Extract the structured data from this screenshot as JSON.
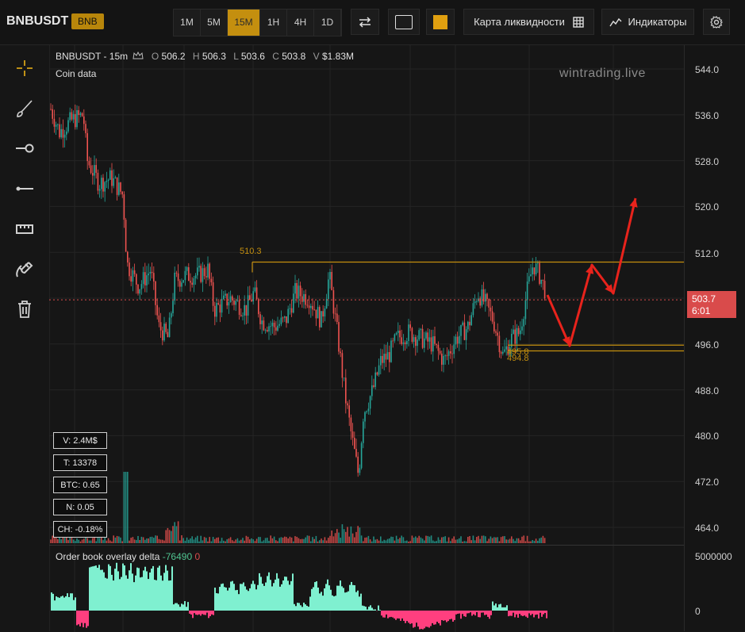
{
  "header": {
    "symbol": "BNBUSDT",
    "asset": "BNB",
    "timeframes": [
      "1M",
      "5M",
      "15M",
      "1H",
      "4H",
      "1D"
    ],
    "active_timeframe": "15M",
    "liquidity_map_label": "Карта ликвидности",
    "indicators_label": "Индикаторы"
  },
  "legend": {
    "title": "BNBUSDT - 15m",
    "o_label": "O",
    "o_value": "506.2",
    "h_label": "H",
    "h_value": "506.3",
    "l_label": "L",
    "l_value": "503.6",
    "c_label": "C",
    "c_value": "503.8",
    "v_label": "V",
    "v_value": "$1.83M",
    "coin_data": "Coin data"
  },
  "watermark": "wintrading.live",
  "stats": {
    "volume": "V: 2.4M$",
    "trades": "T: 13378",
    "btc": "BTC: 0.65",
    "n": "N: 0.05",
    "change": "CH: -0.18%"
  },
  "price_axis": {
    "ticks": [
      "544.0",
      "536.0",
      "528.0",
      "520.0",
      "512.0",
      "496.0",
      "488.0",
      "480.0",
      "472.0",
      "464.0"
    ],
    "current_price": "503.7",
    "countdown": "6:01"
  },
  "levels": {
    "resistance_label": "510.3",
    "support_label_1": "495.8",
    "support_label_2": "494.8"
  },
  "delta_panel": {
    "title": "Order book overlay delta",
    "value_pos": "-76490",
    "value_neg": "0",
    "ticks": [
      "5000000",
      "0"
    ]
  },
  "colors": {
    "accent": "#c48f0f",
    "up": "#26a69a",
    "down": "#ef5350",
    "arrow": "#e8231c",
    "delta_pos": "#7ff0d0",
    "delta_neg": "#ff3f7f"
  },
  "icons": {
    "crosshair": "crosshair-icon",
    "brush": "brush-icon",
    "ray": "ray-icon",
    "line": "line-icon",
    "ruler": "ruler-icon",
    "magnet": "magnet-icon",
    "trash": "trash-icon",
    "swap": "swap-icon",
    "settings": "gear-icon"
  }
}
